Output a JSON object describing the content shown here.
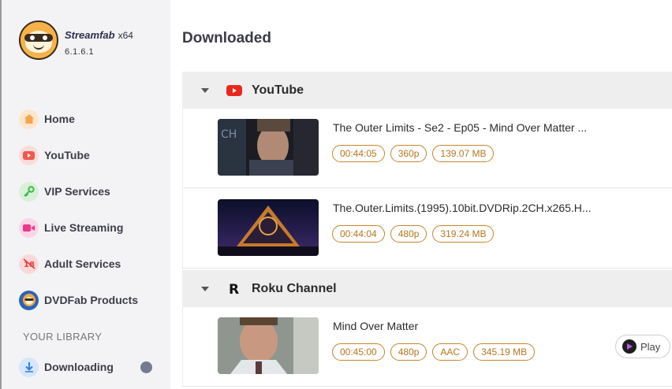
{
  "app": {
    "name": "Streamfab",
    "arch": "x64",
    "version": "6.1.6.1"
  },
  "sidebar": {
    "items": [
      {
        "label": "Home",
        "icon": "home-icon",
        "color": "#f5a449"
      },
      {
        "label": "YouTube",
        "icon": "youtube-icon",
        "color": "#f0584f"
      },
      {
        "label": "VIP Services",
        "icon": "key-icon",
        "color": "#40b84a"
      },
      {
        "label": "Live Streaming",
        "icon": "video-camera-icon",
        "color": "#e9398c"
      },
      {
        "label": "Adult Services",
        "icon": "no-18-icon",
        "color": "#e84040"
      },
      {
        "label": "DVDFab Products",
        "icon": "dvdfab-icon",
        "color": "#2a64b8"
      }
    ],
    "library_title": "YOUR LIBRARY",
    "downloading_label": "Downloading"
  },
  "main": {
    "title": "Downloaded",
    "groups": [
      {
        "name": "YouTube",
        "icon": "youtube-icon",
        "items": [
          {
            "title": "The Outer Limits - Se2 - Ep05 - Mind Over Matter ...",
            "duration": "00:44:05",
            "resolution": "360p",
            "size": "139.07 MB"
          },
          {
            "title": "The.Outer.Limits.(1995).10bit.DVDRip.2CH.x265.H...",
            "duration": "00:44:04",
            "resolution": "480p",
            "size": "319.24 MB"
          }
        ]
      },
      {
        "name": "Roku Channel",
        "icon": "roku-icon",
        "items": [
          {
            "title": "Mind Over Matter",
            "duration": "00:45:00",
            "resolution": "480p",
            "audio": "AAC",
            "size": "345.19 MB",
            "play_label": "Play"
          }
        ]
      }
    ]
  },
  "colors": {
    "tag_border": "#c8842a",
    "tag_text": "#b5761d",
    "sidebar_bg": "#f3f3f5",
    "group_header_bg": "#eeeeef"
  }
}
